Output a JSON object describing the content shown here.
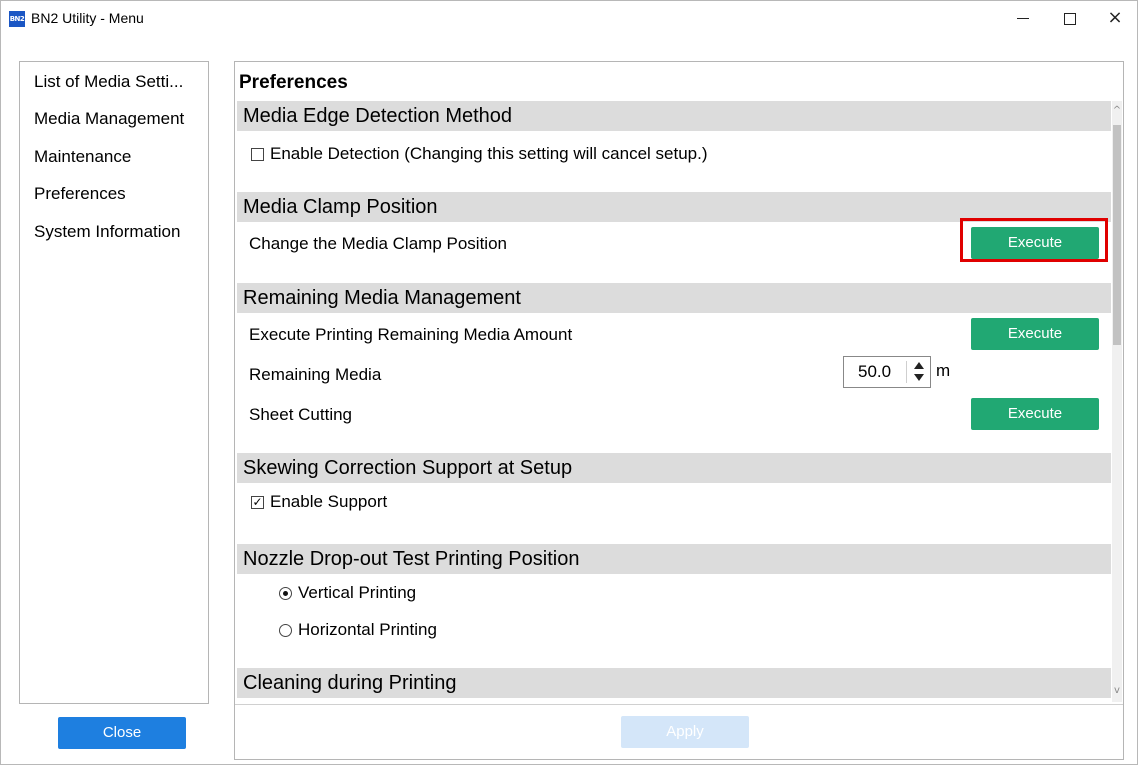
{
  "window": {
    "title": "BN2 Utility - Menu",
    "icon_text": "BN2",
    "controls": {
      "minimize": "minimize-icon",
      "maximize": "maximize-icon",
      "close": "×"
    }
  },
  "sidebar": {
    "items": [
      {
        "label": "List of Media Setti..."
      },
      {
        "label": "Media Management"
      },
      {
        "label": "Maintenance"
      },
      {
        "label": "Preferences"
      },
      {
        "label": "System Information"
      }
    ],
    "close_label": "Close"
  },
  "main": {
    "title": "Preferences",
    "sections": [
      {
        "header": "Media Edge Detection Method",
        "checkbox_label": "Enable Detection (Changing this setting will cancel setup.)",
        "checked": false
      },
      {
        "header": "Media Clamp Position",
        "rows": [
          {
            "label": "Change the Media Clamp Position",
            "button": "Execute"
          }
        ]
      },
      {
        "header": "Remaining Media Management",
        "rows": [
          {
            "label": "Execute Printing Remaining Media Amount",
            "button": "Execute"
          },
          {
            "label": "Remaining Media",
            "value": "50.0",
            "unit": "m"
          },
          {
            "label": "Sheet Cutting",
            "button": "Execute"
          }
        ]
      },
      {
        "header": "Skewing Correction Support at Setup",
        "checkbox_label": "Enable Support",
        "checked": true
      },
      {
        "header": "Nozzle Drop-out Test Printing Position",
        "options": [
          {
            "label": "Vertical Printing",
            "selected": true
          },
          {
            "label": "Horizontal Printing",
            "selected": false
          }
        ]
      },
      {
        "header": "Cleaning during Printing"
      }
    ],
    "apply_label": "Apply"
  },
  "colors": {
    "execute_button": "#21a873",
    "close_button": "#1e7fe0",
    "apply_button_disabled": "#d4e6f9",
    "section_header_bg": "#dcdcdc",
    "highlight": "#e00000"
  }
}
